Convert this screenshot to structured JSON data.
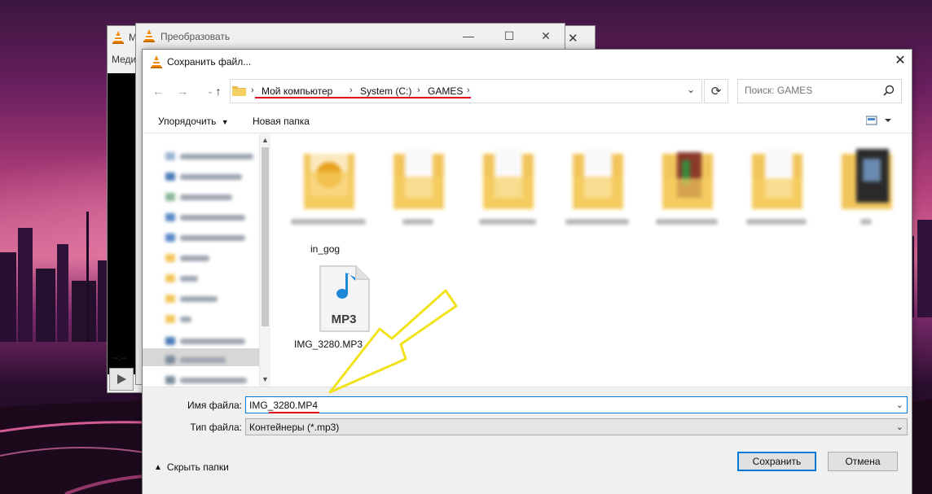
{
  "vlc": {
    "menu_label": "Меди",
    "time_label": "--:--"
  },
  "convert_dialog": {
    "title": "Преобразовать"
  },
  "save_dialog": {
    "title": "Сохранить файл...",
    "breadcrumb": [
      "Мой компьютер",
      "System (C:)",
      "GAMES"
    ],
    "search_placeholder": "Поиск: GAMES",
    "toolbar": {
      "organize_label": "Упорядочить",
      "new_folder_label": "Новая папка"
    },
    "files": [
      {
        "name": "IMG_3280.MP3",
        "type": "mp3",
        "icon_caption": "MP3"
      }
    ],
    "partial_label": "in_gog",
    "form": {
      "filename_label": "Имя файла:",
      "filename_value": "IMG_3280.MP4",
      "filetype_label": "Тип файла:",
      "filetype_value": "Контейнеры (*.mp3)"
    },
    "hide_folders_label": "Скрыть папки",
    "save_label": "Сохранить",
    "cancel_label": "Отмена"
  },
  "colors": {
    "accent": "#0078d7",
    "annotation_red": "#e0001a",
    "annotation_arrow": "#f2e21a",
    "folder": "#f2c55c"
  }
}
